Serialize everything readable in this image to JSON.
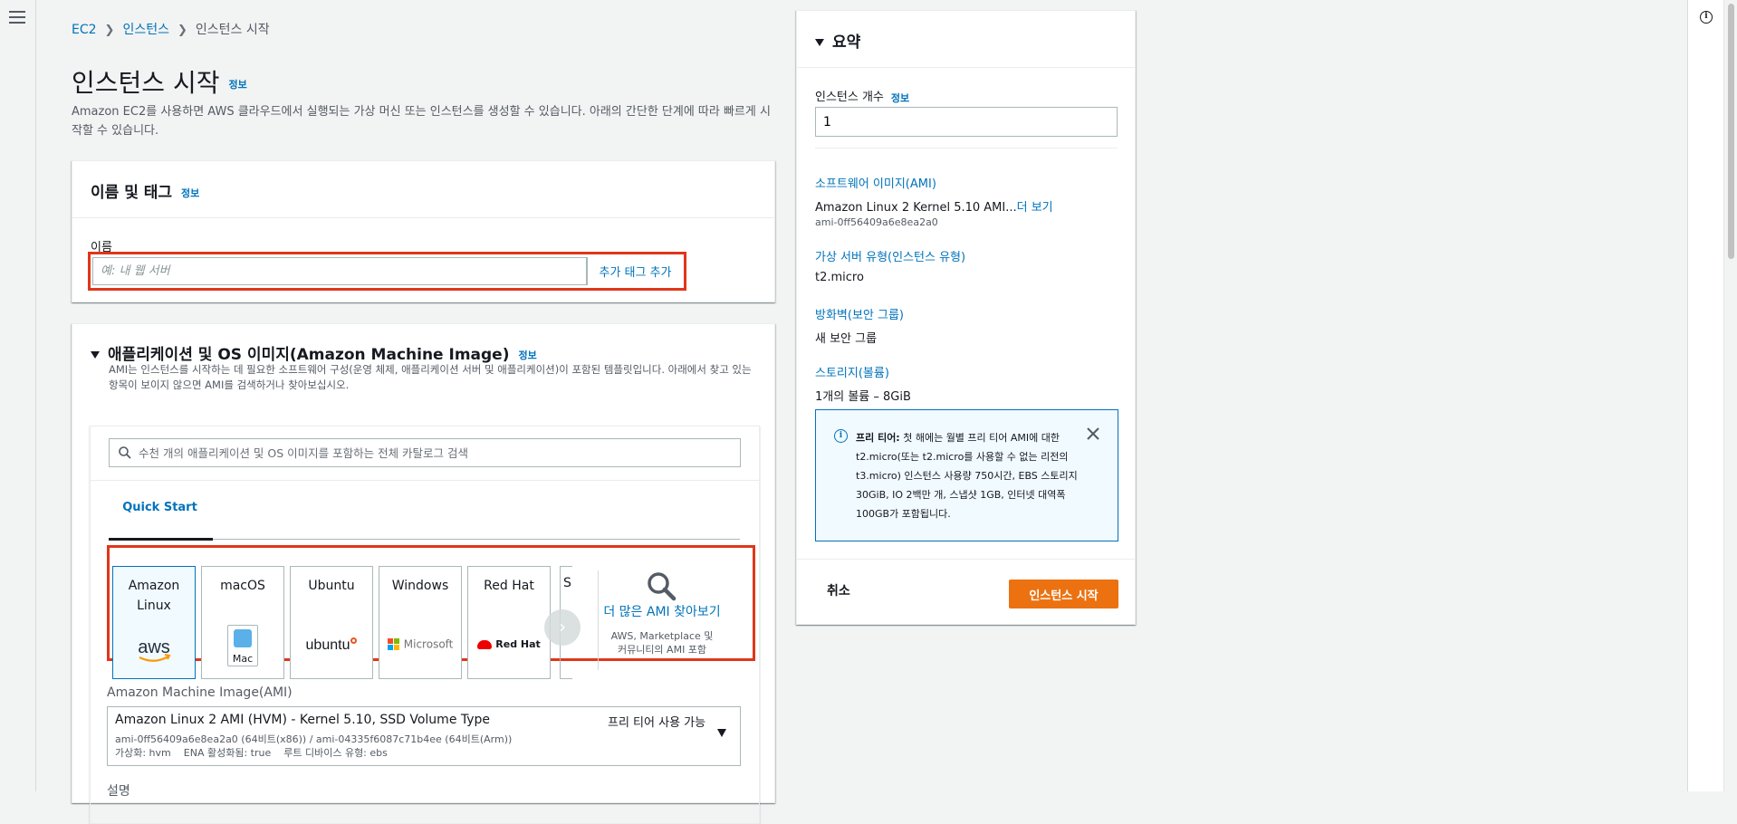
{
  "breadcrumb": {
    "root": "EC2",
    "parent": "인스턴스",
    "current": "인스턴스 시작"
  },
  "page": {
    "title": "인스턴스 시작",
    "info": "정보",
    "description": "Amazon EC2를 사용하면 AWS 클라우드에서 실행되는 가상 머신 또는 인스턴스를 생성할 수 있습니다. 아래의 간단한 단계에 따라 빠르게 시작할 수 있습니다."
  },
  "name_tags": {
    "title": "이름 및 태그",
    "info": "정보",
    "name_label": "이름",
    "name_placeholder": "예: 내 웹 서버",
    "add_tag": "추가 태그 추가"
  },
  "ami": {
    "title": "애플리케이션 및 OS 이미지(Amazon Machine Image)",
    "info": "정보",
    "description": "AMI는 인스턴스를 시작하는 데 필요한 소프트웨어 구성(운영 체제, 애플리케이션 서버 및 애플리케이션)이 포함된 템플릿입니다. 아래에서 찾고 있는 항목이 보이지 않으면 AMI를 검색하거나 찾아보십시오.",
    "search_placeholder": "수천 개의 애플리케이션 및 OS 이미지를 포함하는 전체 카탈로그 검색",
    "tab": "Quick Start",
    "os_options": [
      {
        "label": "Amazon Linux",
        "logo": "aws"
      },
      {
        "label": "macOS",
        "logo": "Mac"
      },
      {
        "label": "Ubuntu",
        "logo": "ubuntu"
      },
      {
        "label": "Windows",
        "logo": "Microsoft"
      },
      {
        "label": "Red Hat",
        "logo": "Red Hat"
      },
      {
        "label": "S",
        "logo": ""
      }
    ],
    "more_link": "더 많은 AMI 찾아보기",
    "more_sub": "AWS, Marketplace 및 커뮤니티의 AMI 포함",
    "ami_label": "Amazon Machine Image(AMI)",
    "selected": {
      "name": "Amazon Linux 2 AMI (HVM) - Kernel 5.10, SSD Volume Type",
      "ids": "ami-0ff56409a6e8ea2a0 (64비트(x86)) / ami-04335f6087c71b4ee (64비트(Arm))",
      "virt": "가상화: hvm",
      "ena": "ENA 활성화됨: true",
      "root": "루트 디바이스 유형: ebs",
      "free": "프리 티어 사용 가능"
    },
    "desc_label": "설명"
  },
  "summary": {
    "title": "요약",
    "count_label": "인스턴스 개수",
    "count_info": "정보",
    "count_value": "1",
    "ami_link": "소프트웨어 이미지(AMI)",
    "ami_value": "Amazon Linux 2 Kernel 5.10 AMI...",
    "ami_more": "더 보기",
    "ami_id": "ami-0ff56409a6e8ea2a0",
    "type_link": "가상 서버 유형(인스턴스 유형)",
    "type_value": "t2.micro",
    "fw_link": "방화벽(보안 그룹)",
    "fw_value": "새 보안 그룹",
    "storage_link": "스토리지(볼륨)",
    "storage_value": "1개의 볼륨 – 8GiB",
    "free_tier_title": "프리 티어:",
    "free_tier_text": "첫 해에는 월별 프리 티어 AMI에 대한 t2.micro(또는 t2.micro를 사용할 수 없는 리전의 t3.micro) 인스턴스 사용량 750시간, EBS 스토리지 30GiB, IO 2백만 개, 스냅샷 1GB, 인터넷 대역폭 100GB가 포함됩니다.",
    "cancel": "취소",
    "launch": "인스턴스 시작"
  },
  "colors": {
    "accent": "#0073bb",
    "launch": "#ec7211",
    "highlight": "#e0361a"
  }
}
